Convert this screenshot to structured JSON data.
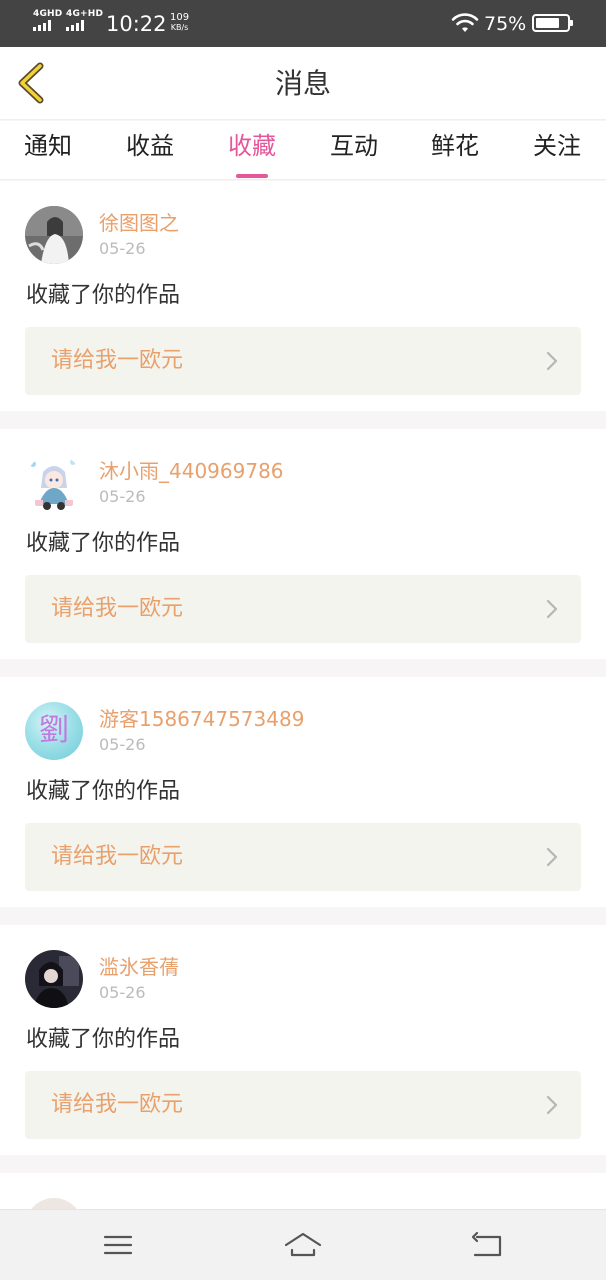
{
  "status_bar": {
    "signal1_label": "4GHD",
    "signal2_label": "4G+HD",
    "time": "10:22",
    "net_speed_value": "109",
    "net_speed_unit": "KB/s",
    "battery_percent": "75%",
    "battery_level": 0.75
  },
  "header": {
    "title": "消息",
    "back_icon": "chevron-left-icon"
  },
  "tabs": [
    {
      "label": "通知",
      "active": false
    },
    {
      "label": "收益",
      "active": false
    },
    {
      "label": "收藏",
      "active": true
    },
    {
      "label": "互动",
      "active": false
    },
    {
      "label": "鲜花",
      "active": false
    },
    {
      "label": "关注",
      "active": false
    }
  ],
  "colors": {
    "accent": "#e5569b",
    "name": "#e8a06c",
    "date": "#bbbbbb",
    "work_bg": "#f4f4ee",
    "status_bar": "#444444"
  },
  "notifications": [
    {
      "user": "徐图图之",
      "date": "05-26",
      "action": "收藏了你的作品",
      "work_title": "请给我一欧元"
    },
    {
      "user": "沐小雨_440969786",
      "date": "05-26",
      "action": "收藏了你的作品",
      "work_title": "请给我一欧元"
    },
    {
      "user": "游客1586747573489",
      "date": "05-26",
      "action": "收藏了你的作品",
      "work_title": "请给我一欧元",
      "avatar_text": "劉"
    },
    {
      "user": "滥氷香蒨",
      "date": "05-26",
      "action": "收藏了你的作品",
      "work_title": "请给我一欧元"
    }
  ],
  "nav_bar": {
    "icons": [
      "menu-icon",
      "home-icon",
      "back-icon"
    ]
  }
}
